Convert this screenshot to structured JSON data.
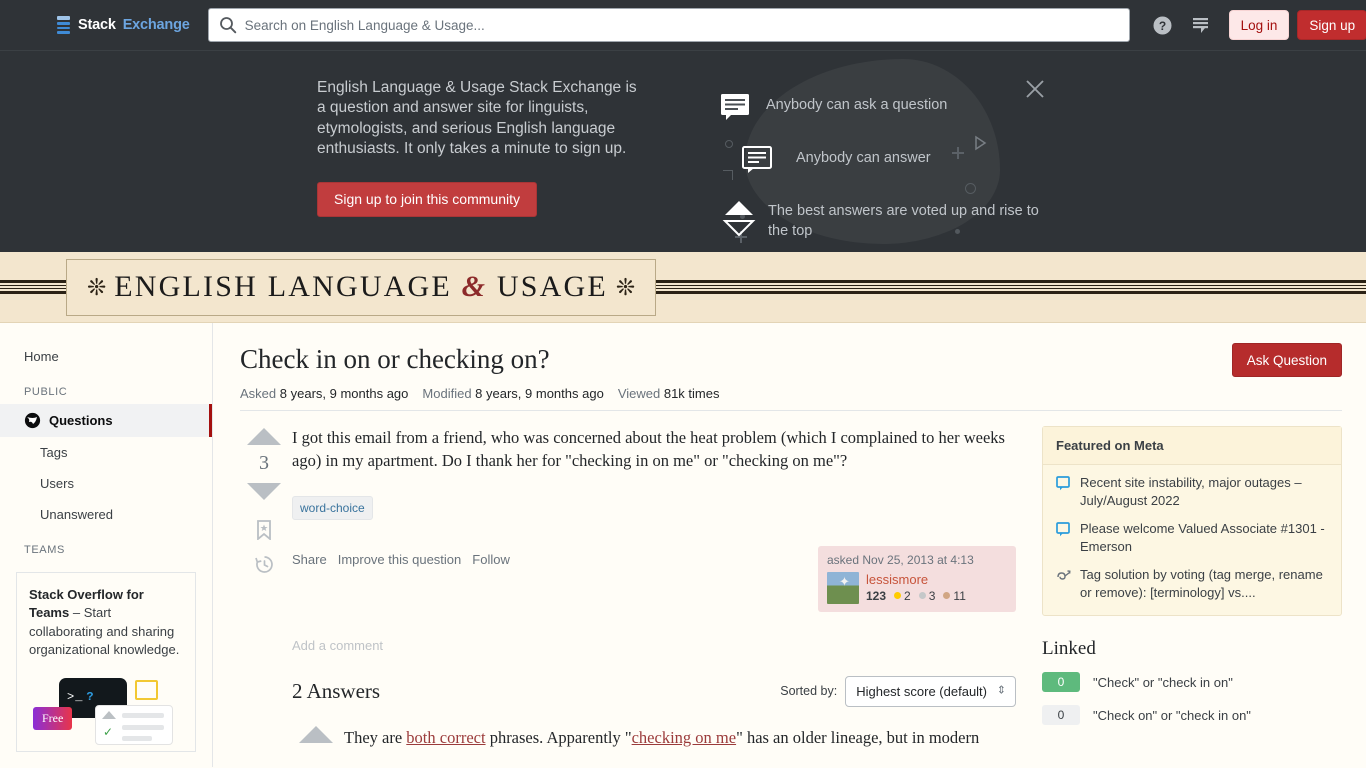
{
  "topbar": {
    "logo_stack": "Stack",
    "logo_exchange": "Exchange",
    "search_placeholder": "Search on English Language & Usage...",
    "search_value": "",
    "help_icon": "help-circle-icon",
    "inbox_icon": "inbox-stack-icon",
    "login_label": "Log in",
    "signup_label": "Sign up"
  },
  "hero": {
    "description": "English Language & Usage Stack Exchange is a question and answer site for linguists, etymologists, and serious English language enthusiasts. It only takes a minute to sign up.",
    "cta_label": "Sign up to join this community",
    "point1": "Anybody can ask a question",
    "point2": "Anybody can answer",
    "point3": "The best answers are voted up and rise to the top",
    "close_icon": "close-icon",
    "play_icon": "play-triangle-icon"
  },
  "sitebar": {
    "title_part1": "ENGLISH LANGUAGE",
    "ampersand": "&",
    "title_part2": "USAGE",
    "ornament": "❊"
  },
  "sidebar": {
    "home_label": "Home",
    "public_heading": "PUBLIC",
    "items": [
      {
        "label": "Questions",
        "icon": "globe-icon",
        "active": true
      },
      {
        "label": "Tags",
        "active": false
      },
      {
        "label": "Users",
        "active": false
      },
      {
        "label": "Unanswered",
        "active": false
      }
    ],
    "teams_heading": "TEAMS",
    "teams_title": "Stack Overflow for Teams",
    "teams_text": " – Start collaborating and sharing organizational knowledge.",
    "teams_free_badge": "Free",
    "teams_terminal": ">_",
    "teams_terminal_q": "?"
  },
  "question": {
    "title": "Check in on or checking on?",
    "ask_button": "Ask Question",
    "asked_label": "Asked",
    "asked_value": "8 years, 9 months ago",
    "modified_label": "Modified",
    "modified_value": "8 years, 9 months ago",
    "viewed_label": "Viewed",
    "viewed_value": "81k times",
    "votes": "3",
    "body": "I got this email from a friend, who was concerned about the heat problem (which I complained to her weeks ago) in my apartment. Do I thank her for \"checking in on me\" or \"checking on me\"?",
    "tags": [
      "word-choice"
    ],
    "actions": [
      "Share",
      "Improve this question",
      "Follow"
    ],
    "bookmark_icon": "bookmark-icon",
    "history_icon": "history-clock-icon",
    "add_comment": "Add a comment"
  },
  "usercard": {
    "asked_when": "asked Nov 25, 2013 at 4:13",
    "username": "lessismore",
    "reputation": "123",
    "gold": "2",
    "silver": "3",
    "bronze": "11"
  },
  "answers": {
    "count_label": "2 Answers",
    "sorted_by_label": "Sorted by:",
    "sort_value": "Highest score (default)",
    "first_answer_pre": "They are ",
    "first_answer_link1": "both correct",
    "first_answer_mid": " phrases. Apparently \"",
    "first_answer_link2": "checking on me",
    "first_answer_post": "\" has an older lineage, but in modern"
  },
  "featured": {
    "heading": "Featured on Meta",
    "items": [
      {
        "text": "Recent site instability, major outages – July/August 2022",
        "icon": "speech-bubble-icon"
      },
      {
        "text": "Please welcome Valued Associate #1301 - Emerson",
        "icon": "speech-bubble-icon"
      },
      {
        "text": "Tag solution by voting (tag merge, rename or remove): [terminology] vs....",
        "icon": "tag-swirl-icon"
      }
    ]
  },
  "linked": {
    "heading": "Linked",
    "items": [
      {
        "score": "0",
        "title": "\"Check\" or \"check in on\"",
        "highlight": true
      },
      {
        "score": "0",
        "title": "\"Check on\" or \"check in on\"",
        "highlight": false
      }
    ]
  },
  "colors": {
    "accent_red": "#B62C2C",
    "topbar_bg": "#2F3337",
    "site_banner_bg": "#F3E6CE",
    "page_bg": "#FFFDF7",
    "link_blue": "#6CA5E0",
    "score_green": "#5EBA7D"
  }
}
